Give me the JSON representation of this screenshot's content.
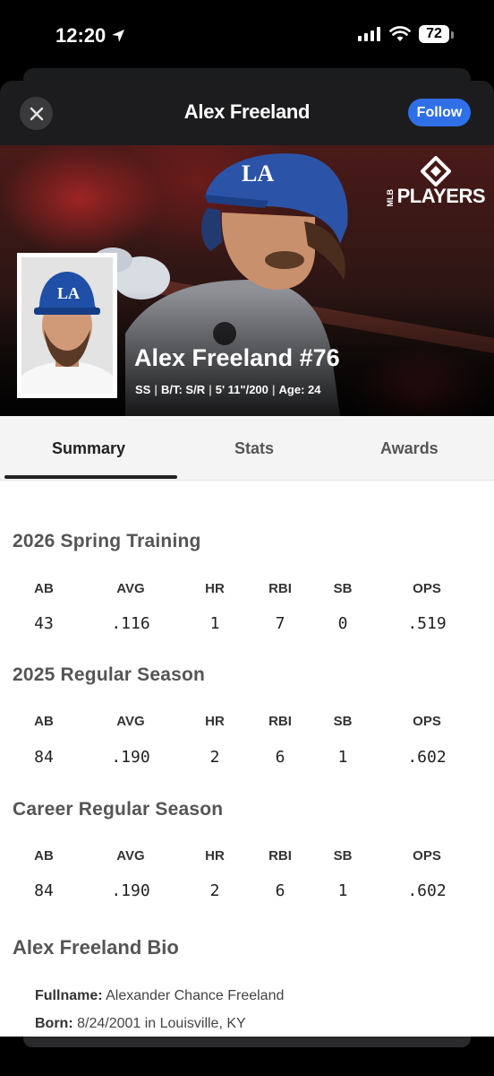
{
  "status": {
    "time": "12:20",
    "battery": "72"
  },
  "header": {
    "title": "Alex Freeland",
    "follow_label": "Follow"
  },
  "hero": {
    "logo_small": "MLB",
    "logo_big": "PLAYERS",
    "player_name": "Alex Freeland #76",
    "meta": [
      "SS",
      "B/T: S/R",
      "5' 11\"/200",
      "Age: 24"
    ]
  },
  "tabs": [
    {
      "label": "Summary",
      "active": true
    },
    {
      "label": "Stats",
      "active": false
    },
    {
      "label": "Awards",
      "active": false
    }
  ],
  "stat_columns": [
    "AB",
    "AVG",
    "HR",
    "RBI",
    "SB",
    "OPS"
  ],
  "sections": [
    {
      "title": "2026 Spring Training",
      "values": [
        "43",
        ".116",
        "1",
        "7",
        "0",
        ".519"
      ]
    },
    {
      "title": "2025 Regular Season",
      "values": [
        "84",
        ".190",
        "2",
        "6",
        "1",
        ".602"
      ]
    },
    {
      "title": "Career Regular Season",
      "values": [
        "84",
        ".190",
        "2",
        "6",
        "1",
        ".602"
      ]
    }
  ],
  "bio": {
    "title": "Alex Freeland Bio",
    "fullname_label": "Fullname:",
    "fullname": "Alexander Chance Freeland",
    "born_label": "Born:",
    "born": "8/24/2001 in Louisville, KY"
  },
  "colors": {
    "follow": "#2f6fe8",
    "header_bg": "#1c1c1e",
    "dodgers_blue": "#1f4fa6"
  }
}
